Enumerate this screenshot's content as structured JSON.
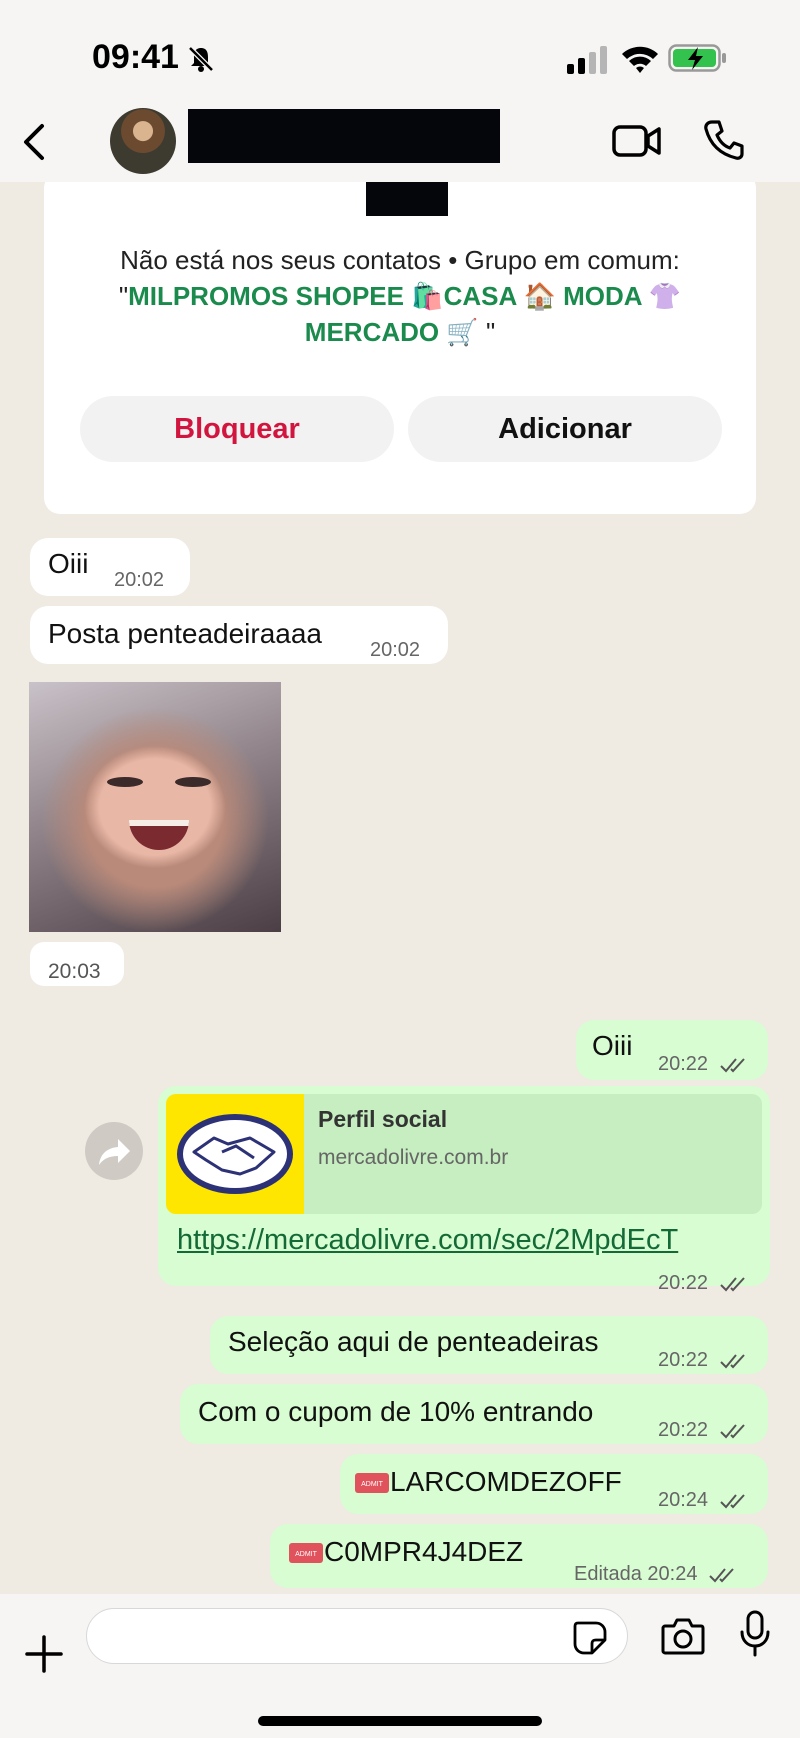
{
  "status_bar": {
    "time": "09:41"
  },
  "header": {
    "avatar": "contact-avatar",
    "icons": [
      "back-icon",
      "video-call-icon",
      "phone-icon"
    ]
  },
  "info_card": {
    "not_in_contacts": "Não está nos seus contatos • Grupo em comum:",
    "group_name_line1": "MILPROMOS SHOPEE 🛍️CASA 🏠 MODA 👚",
    "group_name_line2": "MERCADO 🛒",
    "block_label": "Bloquear",
    "add_label": "Adicionar"
  },
  "messages": {
    "m1": {
      "text": "Oiii",
      "time": "20:02"
    },
    "m2": {
      "text": "Posta penteadeiraaaa",
      "time": "20:02"
    },
    "m3": {
      "time": "20:03"
    },
    "m4": {
      "text": "Oiii",
      "time": "20:22"
    },
    "m5": {
      "preview_title": "Perfil social",
      "preview_domain": "mercadolivre.com.br",
      "url": "https://mercadolivre.com/sec/2MpdEcT",
      "time": "20:22"
    },
    "m6": {
      "text": "Seleção aqui de penteadeiras",
      "time": "20:22"
    },
    "m7": {
      "text": "Com o cupom de 10% entrando",
      "time": "20:22"
    },
    "m8": {
      "text": "LARCOMDEZOFF",
      "time": "20:24"
    },
    "m9": {
      "text": "C0MPR4J4DEZ",
      "edited": "Editada",
      "time": "20:24"
    }
  },
  "input": {
    "placeholder": ""
  },
  "colors": {
    "accent_green": "#1a8a4d",
    "block_red": "#d1153e",
    "outgoing_bubble": "#d8fdd2",
    "incoming_bubble": "#ffffff"
  }
}
